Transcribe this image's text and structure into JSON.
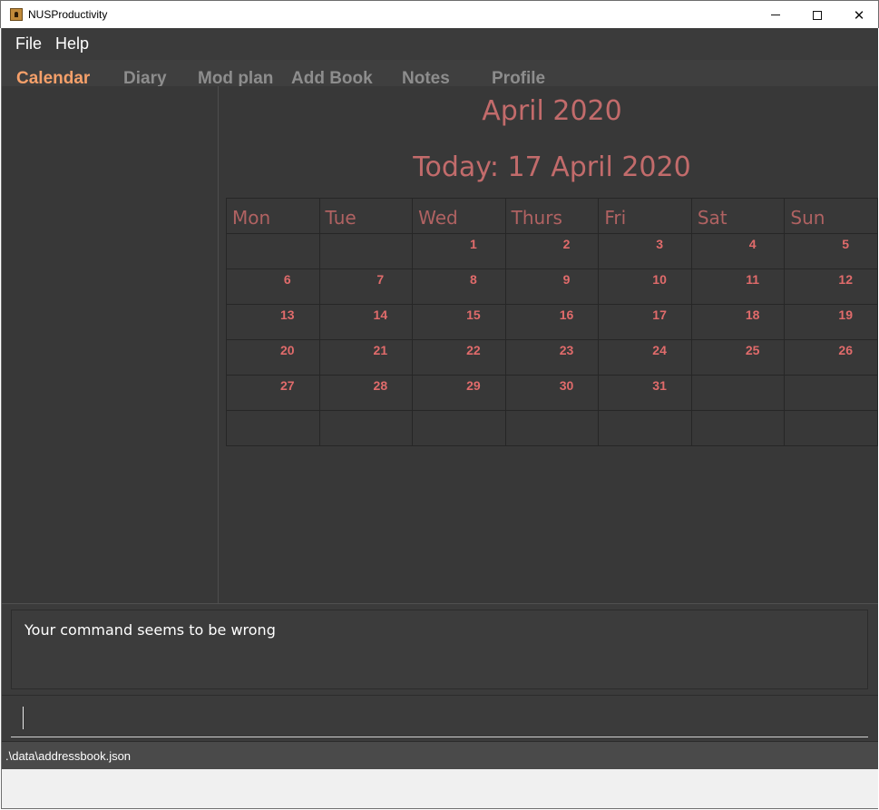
{
  "window": {
    "title": "NUSProductivity",
    "minimize_symbol": "",
    "close_symbol": "✕"
  },
  "menu": {
    "file": "File",
    "help": "Help"
  },
  "tabs": [
    {
      "label": "Calendar",
      "active": true
    },
    {
      "label": "Diary",
      "active": false
    },
    {
      "label": "Mod plan",
      "active": false
    },
    {
      "label": "Add Book",
      "active": false
    },
    {
      "label": "Notes",
      "active": false
    },
    {
      "label": "Profile",
      "active": false
    }
  ],
  "calendar": {
    "month_title": "April 2020",
    "today_label": "Today: 17 April 2020",
    "weekdays": [
      "Mon",
      "Tue",
      "Wed",
      "Thurs",
      "Fri",
      "Sat",
      "Sun"
    ],
    "weeks": [
      [
        "",
        "",
        "1",
        "2",
        "3",
        "4",
        "5"
      ],
      [
        "6",
        "7",
        "8",
        "9",
        "10",
        "11",
        "12"
      ],
      [
        "13",
        "14",
        "15",
        "16",
        "17",
        "18",
        "19"
      ],
      [
        "20",
        "21",
        "22",
        "23",
        "24",
        "25",
        "26"
      ],
      [
        "27",
        "28",
        "29",
        "30",
        "31",
        "",
        ""
      ],
      [
        "",
        "",
        "",
        "",
        "",
        "",
        ""
      ]
    ]
  },
  "result": {
    "message": "Your command seems to be wrong"
  },
  "command": {
    "value": ""
  },
  "status": {
    "file_path": ".\\data\\addressbook.json"
  },
  "colors": {
    "accent_active_tab": "#f5a06a",
    "calendar_text": "#c26b6b",
    "background": "#3b3b3b"
  }
}
